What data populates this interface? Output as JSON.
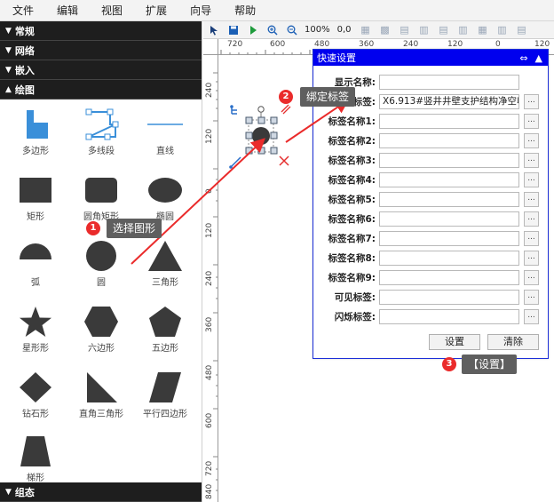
{
  "menu": [
    "文件",
    "编辑",
    "视图",
    "扩展",
    "向导",
    "帮助"
  ],
  "left_panel": {
    "sections_top": [
      {
        "label": "常规",
        "arrow": "▼"
      },
      {
        "label": "网络",
        "arrow": "▼"
      },
      {
        "label": "嵌入",
        "arrow": "▼"
      },
      {
        "label": "绘图",
        "arrow": "▲"
      }
    ],
    "section_bottom": {
      "label": "组态",
      "arrow": "▼"
    },
    "shapes": [
      {
        "label": "多边形",
        "icon": "polygon-icon"
      },
      {
        "label": "多线段",
        "icon": "polyline-icon"
      },
      {
        "label": "直线",
        "icon": "line-icon"
      },
      {
        "label": "矩形",
        "icon": "rectangle-icon"
      },
      {
        "label": "圆角矩形",
        "icon": "rounded-rectangle-icon"
      },
      {
        "label": "椭圆",
        "icon": "ellipse-icon"
      },
      {
        "label": "弧",
        "icon": "arc-icon"
      },
      {
        "label": "圆",
        "icon": "circle-icon"
      },
      {
        "label": "三角形",
        "icon": "triangle-icon"
      },
      {
        "label": "星形形",
        "icon": "star-icon"
      },
      {
        "label": "六边形",
        "icon": "hexagon-icon"
      },
      {
        "label": "五边形",
        "icon": "pentagon-icon"
      },
      {
        "label": "钻石形",
        "icon": "diamond-icon"
      },
      {
        "label": "直角三角形",
        "icon": "right-triangle-icon"
      },
      {
        "label": "平行四边形",
        "icon": "parallelogram-icon"
      },
      {
        "label": "梯形",
        "icon": "trapezoid-icon"
      }
    ]
  },
  "toolbar": {
    "zoom": "100%",
    "coords": "0,0"
  },
  "rulers": {
    "h_ticks": [
      "720",
      "600",
      "480",
      "360",
      "240",
      "120",
      "0",
      "120"
    ],
    "v_ticks": [
      "240",
      "120",
      "0",
      "120",
      "240",
      "360",
      "480",
      "600",
      "720",
      "840"
    ]
  },
  "quick_settings": {
    "title": "快速设置",
    "fields": [
      {
        "label": "显示名称:",
        "value": ""
      },
      {
        "label": "数据标签:",
        "value": "X6.913#竖井井壁支护结构净空收"
      },
      {
        "label": "标签名称1:",
        "value": ""
      },
      {
        "label": "标签名称2:",
        "value": ""
      },
      {
        "label": "标签名称3:",
        "value": ""
      },
      {
        "label": "标签名称4:",
        "value": ""
      },
      {
        "label": "标签名称5:",
        "value": ""
      },
      {
        "label": "标签名称6:",
        "value": ""
      },
      {
        "label": "标签名称7:",
        "value": ""
      },
      {
        "label": "标签名称8:",
        "value": ""
      },
      {
        "label": "标签名称9:",
        "value": ""
      },
      {
        "label": "可见标签:",
        "value": ""
      },
      {
        "label": "闪烁标签:",
        "value": ""
      }
    ],
    "browse_label": "...",
    "set_button": "设置",
    "clear_button": "清除"
  },
  "annotations": {
    "step1": {
      "num": "1",
      "text": "选择图形"
    },
    "step2": {
      "num": "2",
      "text": "绑定标签"
    },
    "step3": {
      "num": "3",
      "text": "【设置】"
    }
  },
  "colors": {
    "accent": "#0000ee",
    "shape": "#3a3a3a",
    "annotation": "#ea2b2b",
    "highlight_shape": "#3a8fd9"
  }
}
